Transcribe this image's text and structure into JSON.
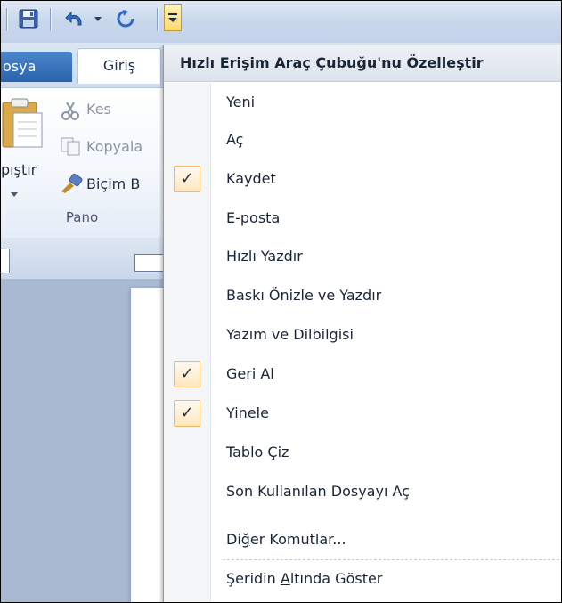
{
  "ribbon": {
    "file_tab": "osya",
    "home_tab": "Giriş",
    "cut": "Kes",
    "copy": "Kopyala",
    "format_painter": "Biçim B",
    "paste": "pıştır",
    "group_label": "Pano"
  },
  "menu": {
    "header": "Hızlı Erişim Araç Çubuğu'nu Özelleştir",
    "items": [
      {
        "label": "Yeni",
        "checked": false
      },
      {
        "label": "Aç",
        "checked": false
      },
      {
        "label": "Kaydet",
        "checked": true
      },
      {
        "label": "E-posta",
        "checked": false
      },
      {
        "label": "Hızlı Yazdır",
        "checked": false
      },
      {
        "label": "Baskı Önizle ve Yazdır",
        "checked": false
      },
      {
        "label": "Yazım ve Dilbilgisi",
        "checked": false
      },
      {
        "label": "Geri Al",
        "checked": true
      },
      {
        "label": "Yinele",
        "checked": true
      },
      {
        "label": "Tablo Çiz",
        "checked": false
      },
      {
        "label": "Son Kullanılan Dosyayı Aç",
        "checked": false
      }
    ],
    "more_commands": {
      "pre": "Di",
      "accel": "ğ",
      "post": "er Komutlar..."
    },
    "show_below": {
      "pre": "Şeridin ",
      "accel": "A",
      "post": "ltında Göster"
    },
    "check_glyph": "✓"
  },
  "colors": {
    "accent": "#2a63ad",
    "highlight_border": "#f0b860",
    "highlight_fill": "#fde7bf"
  }
}
